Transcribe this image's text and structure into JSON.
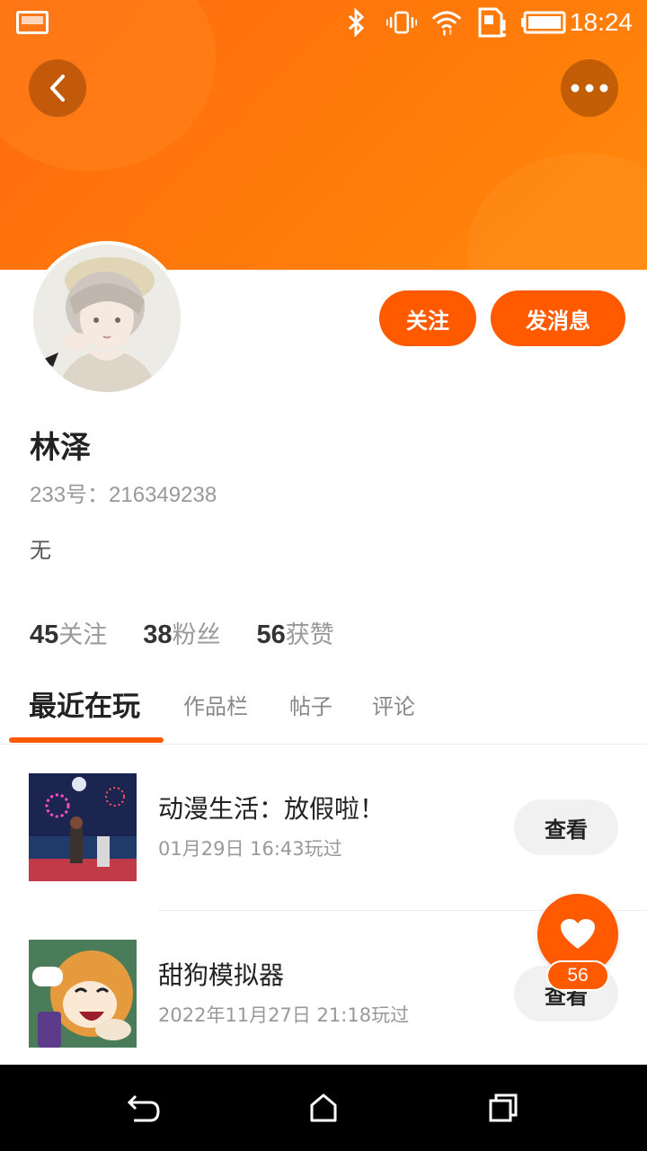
{
  "status_bar": {
    "time": "18:24",
    "icons": [
      "gallery-icon",
      "bluetooth-icon",
      "vibrate-icon",
      "wifi-icon",
      "sim-icon",
      "battery-icon"
    ]
  },
  "header": {
    "back_icon": "chevron-left-icon",
    "more_icon": "more-dots-icon"
  },
  "profile": {
    "name": "林泽",
    "uid": "233号：216349238",
    "bio": "无",
    "follow_label": "关注",
    "message_label": "发消息"
  },
  "stats": [
    {
      "num": "45",
      "label": "关注"
    },
    {
      "num": "38",
      "label": "粉丝"
    },
    {
      "num": "56",
      "label": "获赞"
    }
  ],
  "tabs": [
    {
      "label": "最近在玩",
      "active": true
    },
    {
      "label": "作品栏",
      "active": false
    },
    {
      "label": "帖子",
      "active": false
    },
    {
      "label": "评论",
      "active": false
    }
  ],
  "recent_games": [
    {
      "title": "动漫生活：放假啦！",
      "played": "01月29日 16:43玩过",
      "button": "查看"
    },
    {
      "title": "甜狗模拟器",
      "played": "2022年11月27日 21:18玩过",
      "button": "查看"
    }
  ],
  "like_fab": {
    "count": "56"
  },
  "nav_bar": {
    "icons": [
      "back-nav-icon",
      "home-nav-icon",
      "recents-nav-icon"
    ]
  },
  "colors": {
    "accent": "#ff5a00",
    "header_gradient_start": "#ff6a0d",
    "header_gradient_end": "#ff8a0c"
  }
}
